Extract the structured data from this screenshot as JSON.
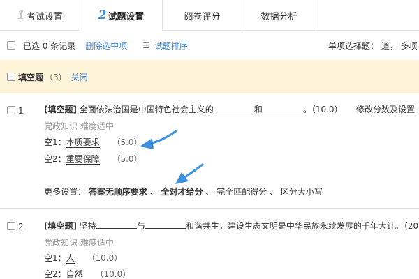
{
  "tabs": [
    {
      "num": "1",
      "label": "考试设置"
    },
    {
      "num": "2",
      "label": "试题设置"
    },
    {
      "label": "阅卷评分"
    },
    {
      "label": "数据分析"
    }
  ],
  "toolbar": {
    "selected_text": "已选 0 条记录",
    "delete_label": "删除选中项",
    "sort_label": "试题排序",
    "right_text": "单项选择题：  道，  多项"
  },
  "section": {
    "title": "填空题",
    "count": "（3）",
    "close_label": "关闭"
  },
  "questions": [
    {
      "num": "1",
      "tag": "[填空题]",
      "text_a": " 全面依法治国是中国特色社会主义的",
      "text_b": "和",
      "text_c": "。（10.0）",
      "edit_label": "修改分数及设置",
      "meta": "党政知识    难度适中",
      "blanks": [
        {
          "label": "空1：",
          "answer": "本质要求",
          "score": "（5.0）"
        },
        {
          "label": "空2：",
          "answer": "重要保障",
          "score": "（5.0）"
        }
      ],
      "more_label": "更多设置：",
      "options": [
        "答案无顺序要求",
        "、",
        "全对才给分",
        "、",
        "完全匹配得分",
        "、",
        "区分大小写"
      ]
    },
    {
      "num": "2",
      "tag": "[填空题]",
      "text_a": " 坚持",
      "text_b": "与",
      "text_c": "和谐共生，建设生态文明是中华民族永续发展的千年大计。（20",
      "meta": "党政知识    难度适中",
      "blanks": [
        {
          "label": "空1：",
          "answer": "人",
          "score": "（10.0）"
        },
        {
          "label": "空2：",
          "answer": "自然",
          "score": "（10.0）"
        }
      ]
    }
  ],
  "colors": {
    "link": "#3a84d6",
    "section_bg": "#fdf3d9",
    "arrow": "#3d8fe0",
    "active_tab_num": "#3d8fe0"
  }
}
